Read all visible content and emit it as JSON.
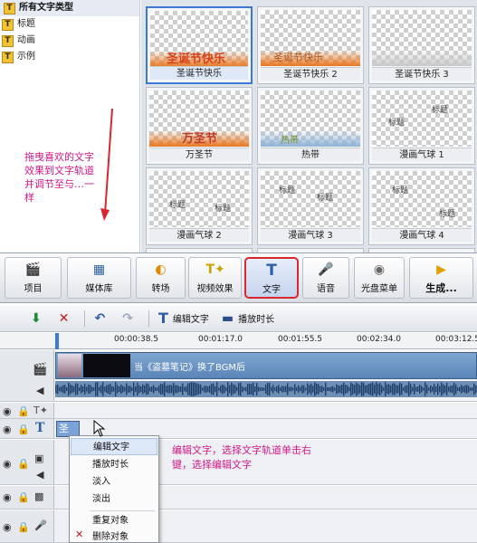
{
  "tree": {
    "root": "所有文字类型",
    "items": [
      {
        "label": "标题"
      },
      {
        "label": "动画"
      },
      {
        "label": "示例"
      }
    ]
  },
  "hint_top": "拖曳喜欢的文字效果到文字轨道   并调节至与…一样",
  "gallery": {
    "tiles": [
      {
        "caption": "圣诞节快乐",
        "overlay": "圣诞节快乐"
      },
      {
        "caption": "圣诞节快乐 2",
        "overlay": "圣诞节快乐"
      },
      {
        "caption": "圣诞节快乐 3"
      },
      {
        "caption": "万圣节",
        "overlay": "万圣节"
      },
      {
        "caption": "热带",
        "overlay": "热带"
      },
      {
        "caption": "漫画气球 1",
        "bubble_a": "标题",
        "bubble_b": "标题"
      },
      {
        "caption": "漫画气球 2",
        "bubble_a": "标题",
        "bubble_b": "标题"
      },
      {
        "caption": "漫画气球 3",
        "bubble_a": "标题",
        "bubble_b": "标题"
      },
      {
        "caption": "漫画气球 4",
        "bubble_a": "标题",
        "bubble_b": "标题"
      }
    ]
  },
  "toolbar": {
    "buttons": [
      {
        "label": "项目",
        "icon": "clapperboard-icon"
      },
      {
        "label": "媒体库",
        "icon": "film-icon"
      },
      {
        "label": "转场",
        "icon": "transition-icon"
      },
      {
        "label": "视频效果",
        "icon": "effects-icon"
      },
      {
        "label": "文字",
        "icon": "text-t-icon"
      },
      {
        "label": "语音",
        "icon": "microphone-icon"
      },
      {
        "label": "光盘菜单",
        "icon": "disc-icon"
      },
      {
        "label": "生成...",
        "icon": "generate-icon"
      }
    ]
  },
  "timeline_toolbar": {
    "edit_text": "编辑文字",
    "duration": "播放时长"
  },
  "ruler": {
    "ticks": [
      "00:00:38.5",
      "00:01:17.0",
      "00:01:55.5",
      "00:02:34.0",
      "00:03:12.5"
    ]
  },
  "video_clip": {
    "label": "当《盗墓笔记》换了BGM后"
  },
  "text_clip": {
    "label": "圣"
  },
  "context_menu": {
    "items": [
      {
        "label": "编辑文字"
      },
      {
        "label": "播放时长"
      },
      {
        "label": "淡入"
      },
      {
        "label": "淡出"
      },
      {
        "label": "重复对象"
      },
      {
        "label": "删除对象"
      }
    ]
  },
  "hint_bottom": "编辑文字，选择文字轨道单击右键，选择编辑文字",
  "colors": {
    "hint": "#d0178a",
    "accent": "#3c78d8",
    "highlight_border": "#d9262f"
  }
}
